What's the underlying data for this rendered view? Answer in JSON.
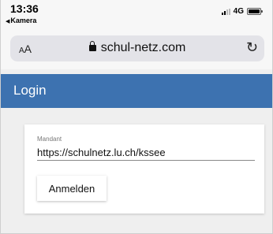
{
  "status_bar": {
    "time": "13:36",
    "back_app": "Kamera",
    "network": "4G"
  },
  "browser": {
    "text_size_label_small": "A",
    "text_size_label_large": "A",
    "url": "schul-netz.com",
    "icons": [
      "lock-icon",
      "reload-icon",
      "signal-icon",
      "battery-icon"
    ]
  },
  "app": {
    "header_title": "Login",
    "header_color": "#3d72b0",
    "form": {
      "field_label": "Mandant",
      "field_value": "https://schulnetz.lu.ch/kssee",
      "submit_label": "Anmelden"
    }
  }
}
